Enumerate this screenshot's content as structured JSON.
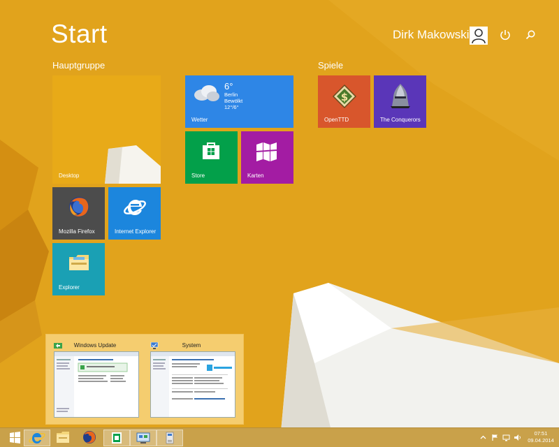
{
  "header": {
    "title": "Start",
    "user_name": "Dirk Makowski"
  },
  "groups": [
    {
      "label": "Hauptgruppe"
    },
    {
      "label": "Spiele"
    }
  ],
  "tiles": {
    "desktop": {
      "label": "Desktop"
    },
    "weather": {
      "label": "Wetter",
      "temp": "6°",
      "city": "Berlin",
      "condition": "Bewölkt",
      "range": "12°/6°"
    },
    "store": {
      "label": "Store"
    },
    "maps": {
      "label": "Karten"
    },
    "firefox": {
      "label": "Mozilla Firefox"
    },
    "ie": {
      "label": "Internet Explorer"
    },
    "explorer": {
      "label": "Explorer"
    },
    "openttd": {
      "label": "OpenTTD"
    },
    "conquerors": {
      "label": "The Conquerors"
    }
  },
  "thumbnails": [
    {
      "title": "Windows Update"
    },
    {
      "title": "System"
    }
  ],
  "taskbar": {
    "time": "07:51",
    "date": "09.04.2014"
  },
  "colors": {
    "background": "#e2a21a",
    "weather_tile": "#2e86e6",
    "store_tile": "#03a04a",
    "maps_tile": "#a31ca3",
    "openttd_tile": "#d8562c",
    "conquerors_tile": "#5a36b8"
  }
}
